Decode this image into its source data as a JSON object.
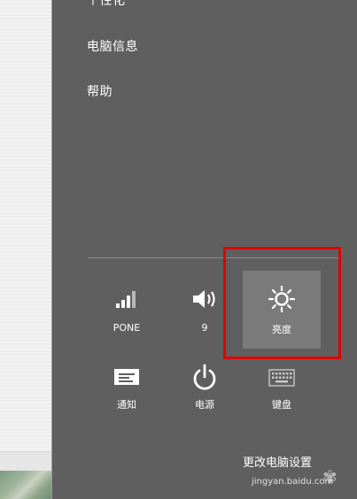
{
  "menu": {
    "top_partial": "个性化",
    "pc_info": "电脑信息",
    "help": "帮助"
  },
  "quick_settings": [
    {
      "id": "network",
      "label": "PONE",
      "icon": "signal-bars-icon"
    },
    {
      "id": "volume",
      "label": "9",
      "icon": "speaker-icon"
    },
    {
      "id": "brightness",
      "label": "亮度",
      "icon": "sun-icon",
      "selected": true
    },
    {
      "id": "notifications",
      "label": "通知",
      "icon": "notification-icon"
    },
    {
      "id": "power",
      "label": "电源",
      "icon": "power-icon"
    },
    {
      "id": "keyboard",
      "label": "键盘",
      "icon": "keyboard-icon"
    }
  ],
  "footer": {
    "change_pc_settings": "更改电脑设置"
  },
  "watermark": {
    "text": "jingyan.baidu.com"
  },
  "colors": {
    "panel_bg": "#5f5f5f",
    "selected_tile": "#7a7a7a",
    "highlight_border": "#e00000"
  }
}
